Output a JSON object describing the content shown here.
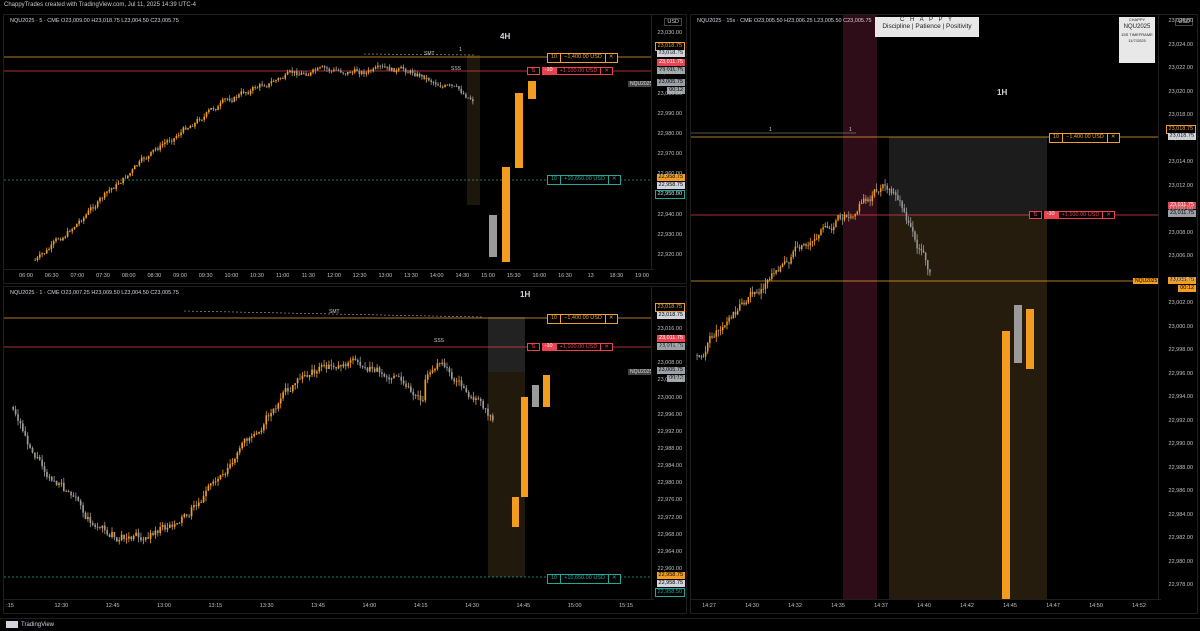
{
  "header": {
    "text": "ChappyTrades created with TradingView.com, Jul 11, 2025 14:39 UTC-4"
  },
  "footer": {
    "brand": "TradingView"
  },
  "colors": {
    "bg": "#000000",
    "bull": "#f39c1f",
    "bear": "#9a9a9a",
    "tp_line": "#f0a030",
    "sl_line": "#e0404a",
    "entry_line": "#26a69a",
    "sl_tag": "#e8434f",
    "price_tag": "#9aa0a6"
  },
  "panels": {
    "p4h": {
      "title": "NQU2025 · 5 · CME  O23,009.00  H23,018.75  L23,004.50  C23,005.75",
      "tf_label": "4H",
      "currency": "USD",
      "price_ticks": [
        "23,030.00",
        "23,020.00",
        "23,010.00",
        "23,000.00",
        "22,990.00",
        "22,980.00",
        "22,970.00",
        "22,960.00",
        "22,950.00",
        "22,940.00",
        "22,930.00",
        "22,920.00"
      ],
      "time_ticks": [
        "06:00",
        "06:30",
        "07:00",
        "07:30",
        "08:00",
        "08:30",
        "09:00",
        "09:30",
        "10:00",
        "10:30",
        "11:00",
        "11:30",
        "12:00",
        "12:30",
        "13:00",
        "13:30",
        "14:00",
        "14:30",
        "15:00",
        "15:30",
        "16:00",
        "16:30",
        "13",
        "18:30",
        "19:00"
      ],
      "tags": {
        "tp": "23,018.75",
        "tp2": "23,018.75",
        "sl": "23,011.75",
        "sl2": "23,011.75",
        "last_sym": "NQU2025",
        "last": "23,005.75",
        "countdown": "00:12",
        "entry": "22,958.75",
        "entry2": "22,958.75",
        "entry3": "22,958.50"
      },
      "annotations": {
        "smt": "SMT",
        "sss": "SSS",
        "one": "1"
      }
    },
    "p1h_left": {
      "title": "NQU2025 · 1 · CME  O23,007.25  H23,009.50  L23,004.50  C23,005.75",
      "tf_label": "1H",
      "price_ticks": [
        "23,016.00",
        "23,012.00",
        "23,008.00",
        "23,004.00",
        "23,000.00",
        "22,996.00",
        "22,992.00",
        "22,988.00",
        "22,984.00",
        "22,980.00",
        "22,976.00",
        "22,972.00",
        "22,968.00",
        "22,964.00",
        "22,960.00"
      ],
      "time_ticks": [
        ":15",
        "12:30",
        "12:45",
        "13:00",
        "13:15",
        "13:30",
        "13:45",
        "14:00",
        "14:15",
        "14:30",
        "14:45",
        "15:00",
        "15:15"
      ],
      "tags": {
        "tp": "23,018.75",
        "tp2": "23,018.75",
        "sl": "23,011.75",
        "sl2": "23,011.75",
        "last_sym": "NQU2025",
        "last": "23,005.75",
        "countdown": "00:12",
        "entry": "22,958.75",
        "entry2": "22,958.75",
        "entry3": "22,958.50"
      },
      "annotations": {
        "smt": "SMT",
        "sss": "SSS"
      }
    },
    "p15s": {
      "title": "NQU2025 · 15s · CME  O23,005.50  H23,006.25  L23,005.50  C23,005.75",
      "tf_label": "1H",
      "currency": "USD",
      "price_ticks": [
        "23,026.00",
        "23,024.00",
        "23,022.00",
        "23,020.00",
        "23,018.00",
        "23,016.00",
        "23,014.00",
        "23,012.00",
        "23,010.00",
        "23,008.00",
        "23,006.00",
        "23,004.00",
        "23,002.00",
        "23,000.00",
        "22,998.00",
        "22,996.00",
        "22,994.00",
        "22,992.00",
        "22,990.00",
        "22,988.00",
        "22,986.00",
        "22,984.00",
        "22,982.00",
        "22,980.00",
        "22,978.00"
      ],
      "time_ticks": [
        "14:27",
        "14:30",
        "14:32",
        "14:35",
        "14:37",
        "14:40",
        "14:42",
        "14:45",
        "14:47",
        "14:50",
        "14:52"
      ],
      "tags": {
        "tp": "23,018.75",
        "tp2": "23,018.75",
        "sl": "23,011.75",
        "sl2": "23,011.75",
        "last_sym": "NQU2025",
        "last": "23,005.75",
        "countdown": "00:12"
      }
    }
  },
  "orders": {
    "tp": {
      "qty": "10",
      "pnl": "−1,400.00 USD",
      "close": "✕"
    },
    "sl": {
      "qty": "-10",
      "pnl": "+1,100.00 USD",
      "close": "✕",
      "icon": "⇅"
    },
    "entry": {
      "qty": "10",
      "pnl": "+10,650.00 USD",
      "close": "✕"
    }
  },
  "logo_main": {
    "line1": "C H A P P Y",
    "line2": "Discipline | Patience | Positivity"
  },
  "logo_small": {
    "line1": "CHAPPY",
    "line2": "NQU2025",
    "line3": "15S TIMEFRAME",
    "line4": "11/7/2025"
  }
}
